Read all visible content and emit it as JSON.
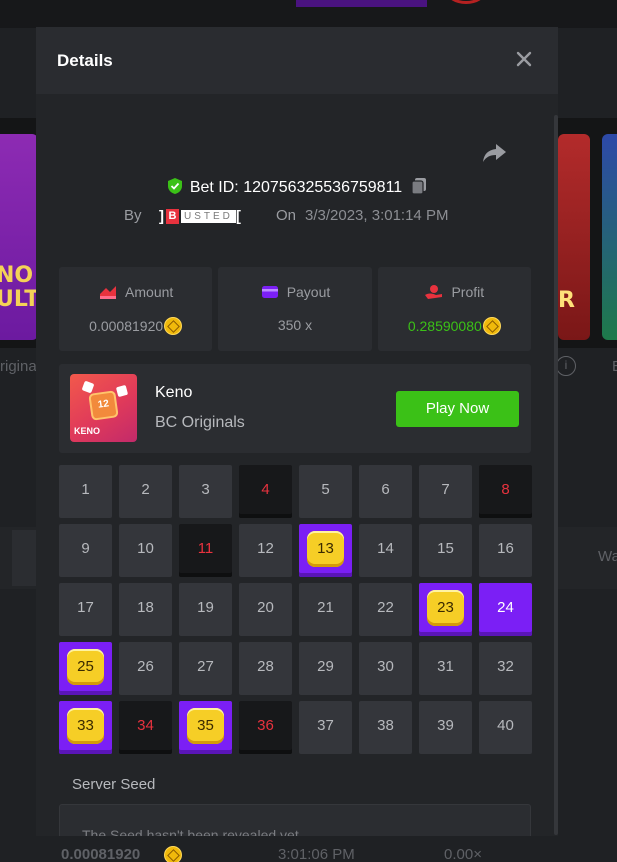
{
  "background": {
    "left_card_text": "NO\nULT",
    "right_card_text": "R",
    "left_label": "rigina",
    "right_label": "B",
    "row_label": "Wa",
    "bottom_row": {
      "amount": "0.00081920",
      "time": "3:01:06 PM",
      "multiplier": "0.00×"
    }
  },
  "modal": {
    "title": "Details",
    "bet_id_label": "Bet ID:",
    "bet_id": "120756325536759811",
    "by_label": "By",
    "username": {
      "left_bracket": "]",
      "initial": "B",
      "rest": "USTED",
      "right_bracket": "["
    },
    "on_label": "On",
    "date": "3/3/2023, 3:01:14 PM",
    "stats": [
      {
        "label": "Amount",
        "value": "0.00081920",
        "icon": "amount-icon",
        "color": "#e8323e"
      },
      {
        "label": "Payout",
        "value": "350 x",
        "icon": "wallet-icon",
        "color": "#7b1ff5"
      },
      {
        "label": "Profit",
        "value": "0.28590080",
        "icon": "profit-hand-icon",
        "color": "#e8323e"
      }
    ],
    "game": {
      "name": "Keno",
      "provider": "BC Originals",
      "thumb_number": "12",
      "thumb_label": "KENO",
      "play_label": "Play Now"
    },
    "grid": {
      "numbers": [
        1,
        2,
        3,
        4,
        5,
        6,
        7,
        8,
        9,
        10,
        11,
        12,
        13,
        14,
        15,
        16,
        17,
        18,
        19,
        20,
        21,
        22,
        23,
        24,
        25,
        26,
        27,
        28,
        29,
        30,
        31,
        32,
        33,
        34,
        35,
        36,
        37,
        38,
        39,
        40
      ],
      "hits": [
        13,
        23,
        25,
        33,
        35
      ],
      "picked_no_hit": [
        24
      ],
      "drawn_misses": [
        4,
        8,
        11,
        34,
        36
      ]
    },
    "server_seed_label": "Server Seed",
    "server_seed_value": "The Seed hasn't been revealed yet"
  },
  "colors": {
    "accent_green": "#3bc117",
    "accent_purple": "#7b1ff5",
    "miss_red": "#e8323e",
    "coin": "#f0b90b"
  }
}
